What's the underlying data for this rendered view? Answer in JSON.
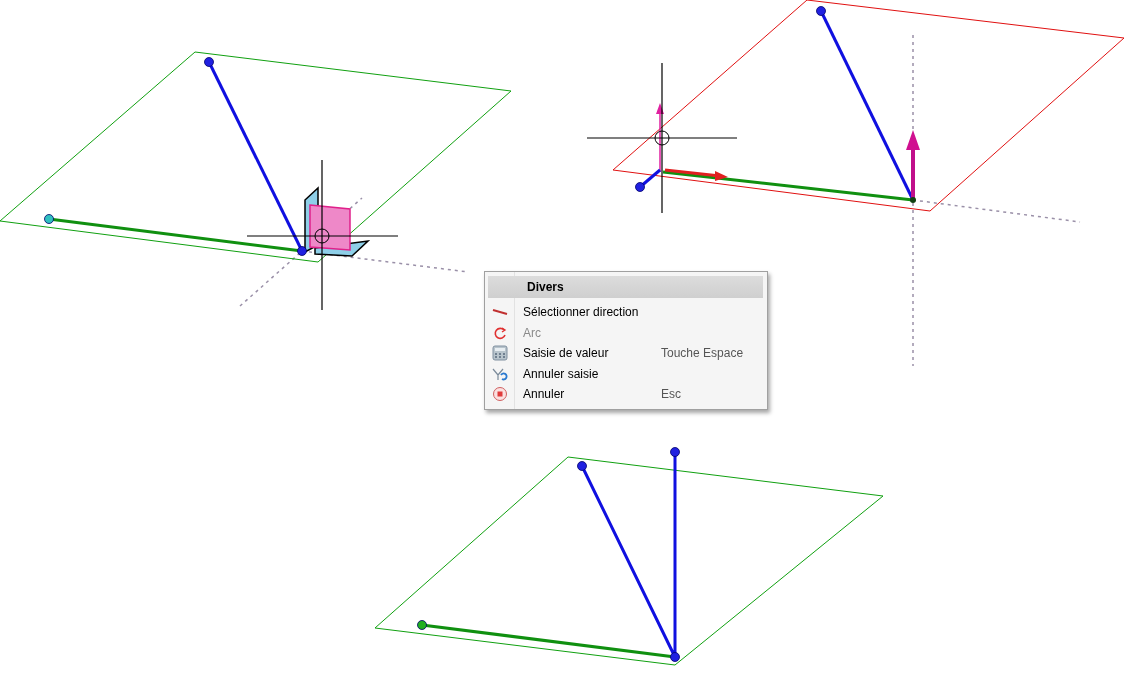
{
  "context_menu": {
    "title": "Divers",
    "items": [
      {
        "kind": "line",
        "label": "Sélectionner direction",
        "disabled": false
      },
      {
        "kind": "arc",
        "label": "Arc",
        "disabled": true
      },
      {
        "kind": "calculator",
        "label": "Saisie de valeur",
        "shortcut": "Touche Espace",
        "disabled": false
      },
      {
        "kind": "undo",
        "label": "Annuler saisie",
        "disabled": false
      },
      {
        "kind": "stop",
        "label": "Annuler",
        "shortcut": "Esc",
        "disabled": false
      }
    ]
  }
}
